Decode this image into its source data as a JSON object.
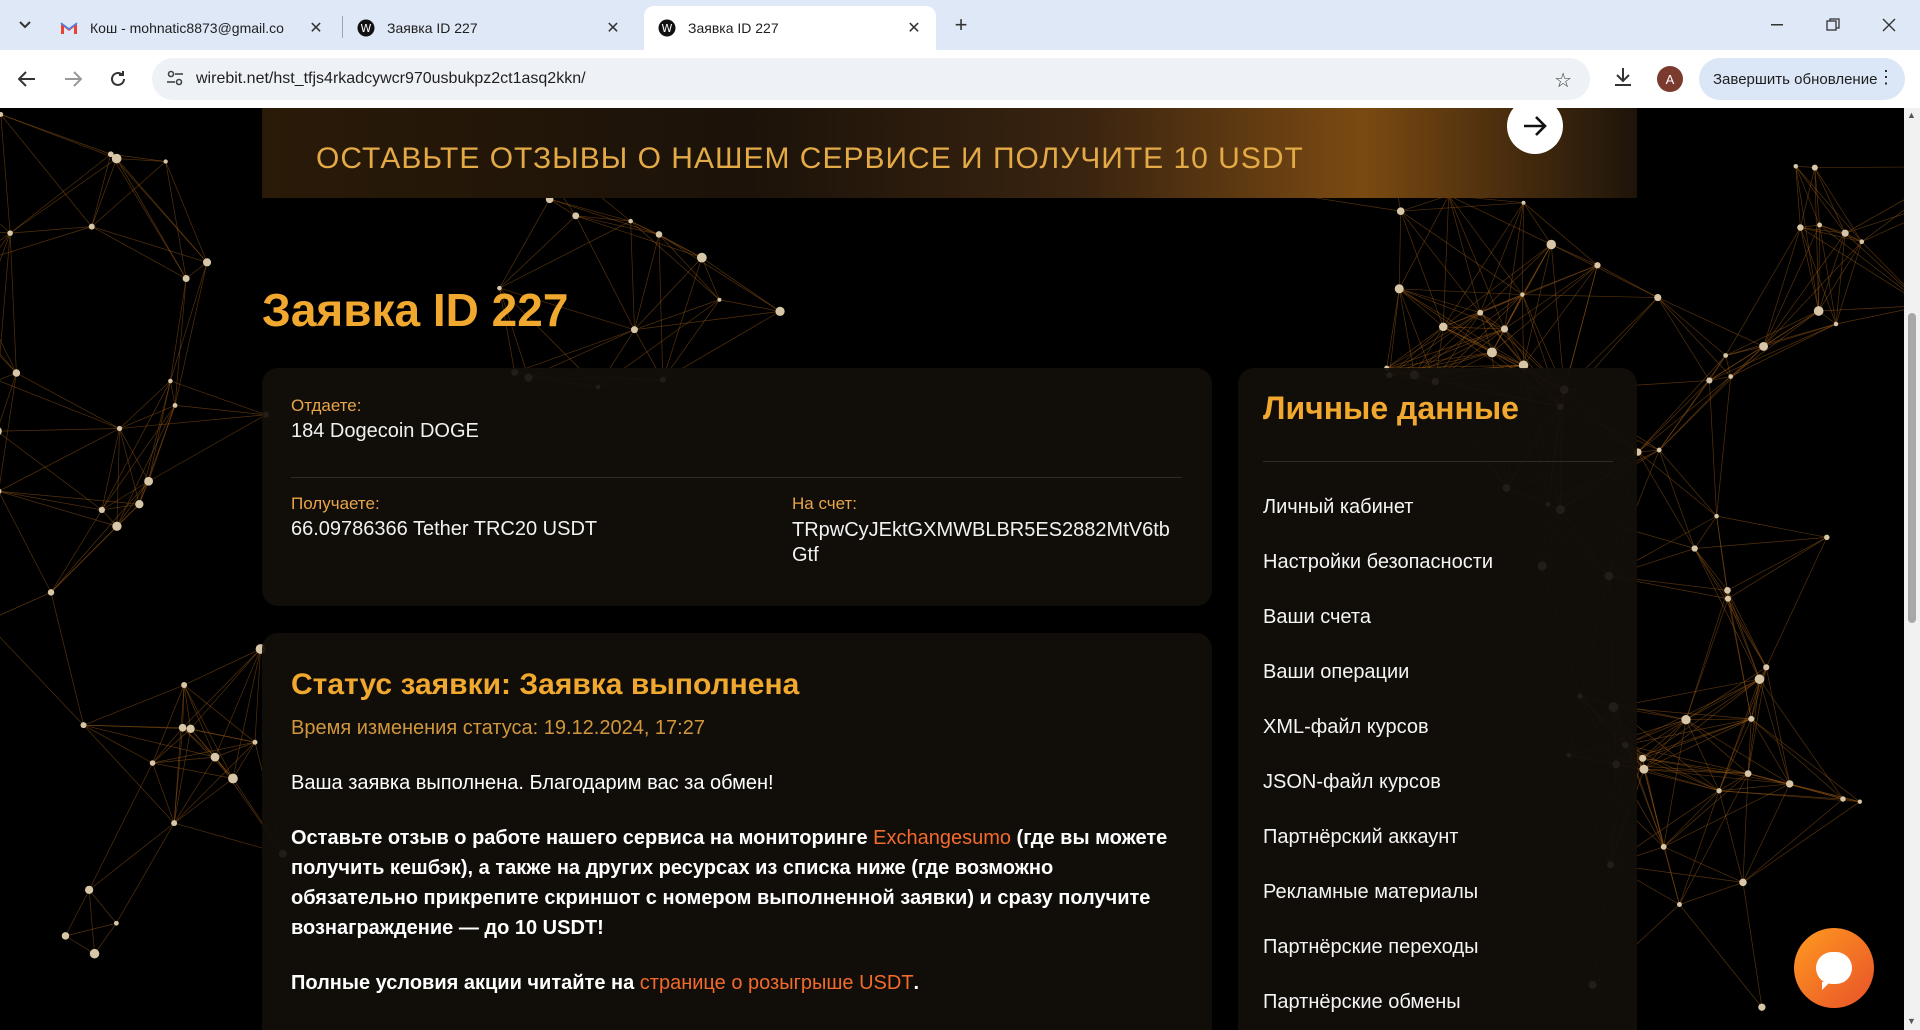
{
  "browser": {
    "tabs": [
      {
        "title": "Кош - mohnatic8873@gmail.co",
        "icon": "gmail-icon"
      },
      {
        "title": "Заявка ID 227",
        "icon": "wirebit-icon"
      },
      {
        "title": "Заявка ID 227",
        "icon": "wirebit-icon"
      }
    ],
    "url": "wirebit.net/hst_tfjs4rkadcywcr970usbukpz2ct1asq2kkn/",
    "avatar_letter": "A",
    "update_label": "Завершить обновление"
  },
  "banner": {
    "text": "ОСТАВЬТЕ ОТЗЫВЫ О НАШЕМ СЕРВИСЕ И ПОЛУЧИТЕ  10 USDT"
  },
  "page_title": "Заявка ID 227",
  "order": {
    "give_label": "Отдаете:",
    "give_value": "184 Dogecoin DOGE",
    "receive_label": "Получаете:",
    "receive_value": "66.09786366 Tether TRC20 USDT",
    "account_label": "На счет:",
    "account_value": "TRpwCyJEktGXMWBLBR5ES2882MtV6tbGtf"
  },
  "status": {
    "title": "Статус заявки: Заявка выполнена",
    "time": "Время изменения статуса: 19.12.2024, 17:27",
    "thanks": "Ваша заявка выполнена. Благодарим вас за обмен!",
    "review_part1": "Оставьте отзыв о работе нашего сервиса на мониторинге ",
    "review_link": "Exchangesumo",
    "review_part2": " (где вы можете получить кешбэк), а также на других ресурсах из списка ниже (где возможно обязательно прикрепите скриншот с номером выполненной заявки) и сразу получите вознаграждение — до 10 USDT!",
    "conditions_part1": "Полные условия акции читайте на ",
    "conditions_link": "странице о розыгрыше USDT",
    "conditions_part2": "."
  },
  "sidebar": {
    "title": "Личные данные",
    "items": [
      "Личный кабинет",
      "Настройки безопасности",
      "Ваши счета",
      "Ваши операции",
      "XML-файл курсов",
      "JSON-файл курсов",
      "Партнёрский аккаунт",
      "Рекламные материалы",
      "Партнёрские переходы",
      "Партнёрские обмены"
    ]
  },
  "colors": {
    "accent": "#f0a82e",
    "link": "#f26b2c",
    "card_bg": "#120e0a",
    "page_bg": "#000000"
  }
}
